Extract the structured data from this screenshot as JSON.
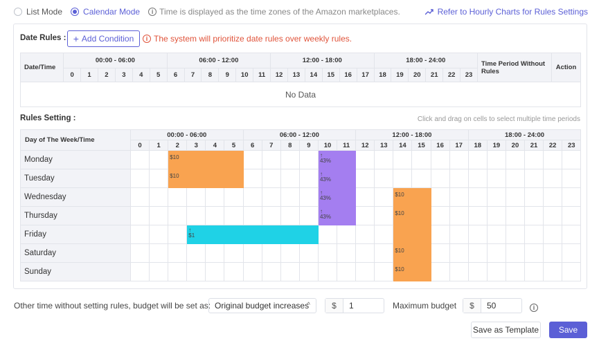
{
  "mode": {
    "list_label": "List Mode",
    "calendar_label": "Calendar Mode",
    "selected": "calendar",
    "timezone_note": "Time is displayed as the time zones of the Amazon marketplaces.",
    "hourly_link": "Refer to Hourly Charts for Rules Settings"
  },
  "date_rules": {
    "title": "Date Rules :",
    "add_button": "Add Condition",
    "warning": "The system will prioritize date rules over weekly rules.",
    "col_datetime": "Date/Time",
    "periods": [
      "00:00 - 06:00",
      "06:00 - 12:00",
      "12:00 - 18:00",
      "18:00 - 24:00"
    ],
    "hours": [
      "0",
      "1",
      "2",
      "3",
      "4",
      "5",
      "6",
      "7",
      "8",
      "9",
      "10",
      "11",
      "12",
      "13",
      "14",
      "15",
      "16",
      "17",
      "18",
      "19",
      "20",
      "21",
      "22",
      "23"
    ],
    "col_without": "Time Period Without Rules",
    "col_action": "Action",
    "empty_text": "No Data"
  },
  "rules_setting": {
    "title": "Rules Setting :",
    "hint": "Click and drag on cells to select multiple time periods",
    "col_day": "Day of The Week/Time",
    "periods": [
      "00:00 - 06:00",
      "06:00 - 12:00",
      "12:00 - 18:00",
      "18:00 - 24:00"
    ],
    "hours": [
      "0",
      "1",
      "2",
      "3",
      "4",
      "5",
      "6",
      "7",
      "8",
      "9",
      "10",
      "11",
      "12",
      "13",
      "14",
      "15",
      "16",
      "17",
      "18",
      "19",
      "20",
      "21",
      "22",
      "23"
    ],
    "days": [
      {
        "name": "Monday",
        "blocks": [
          {
            "start": 2,
            "end": 6,
            "color": "orange",
            "label": "$10",
            "arrow": false
          },
          {
            "start": 10,
            "end": 12,
            "color": "purple",
            "label": "43%",
            "arrow": true
          }
        ]
      },
      {
        "name": "Tuesday",
        "blocks": [
          {
            "start": 2,
            "end": 6,
            "color": "orange",
            "label": "$10",
            "arrow": false
          },
          {
            "start": 10,
            "end": 12,
            "color": "purple",
            "label": "43%",
            "arrow": true
          }
        ]
      },
      {
        "name": "Wednesday",
        "blocks": [
          {
            "start": 10,
            "end": 12,
            "color": "purple",
            "label": "43%",
            "arrow": true
          },
          {
            "start": 14,
            "end": 16,
            "color": "orange",
            "label": "$10",
            "arrow": false
          }
        ]
      },
      {
        "name": "Thursday",
        "blocks": [
          {
            "start": 10,
            "end": 12,
            "color": "purple",
            "label": "43%",
            "arrow": true
          },
          {
            "start": 14,
            "end": 16,
            "color": "orange",
            "label": "$10",
            "arrow": false
          }
        ]
      },
      {
        "name": "Friday",
        "blocks": [
          {
            "start": 3,
            "end": 10,
            "color": "cyan",
            "label": "$1",
            "arrow": true
          },
          {
            "start": 14,
            "end": 16,
            "color": "orange",
            "label": "",
            "arrow": false
          }
        ]
      },
      {
        "name": "Saturday",
        "blocks": [
          {
            "start": 14,
            "end": 16,
            "color": "orange",
            "label": "$10",
            "arrow": false
          }
        ]
      },
      {
        "name": "Sunday",
        "blocks": [
          {
            "start": 14,
            "end": 16,
            "color": "orange",
            "label": "$10",
            "arrow": false
          }
        ]
      }
    ]
  },
  "colors": {
    "orange": "#f9a350",
    "purple": "#a47ef0",
    "cyan": "#1fd2e6",
    "accent": "#5b5fd6",
    "warning": "#e0533a"
  },
  "footer": {
    "other_time_text": "Other time without setting rules, budget will be set as:",
    "budget_option": "Original budget increases",
    "currency": "$",
    "increase_value": "1",
    "max_label": "Maximum budget",
    "max_value": "50",
    "save_template": "Save as Template",
    "save": "Save"
  }
}
